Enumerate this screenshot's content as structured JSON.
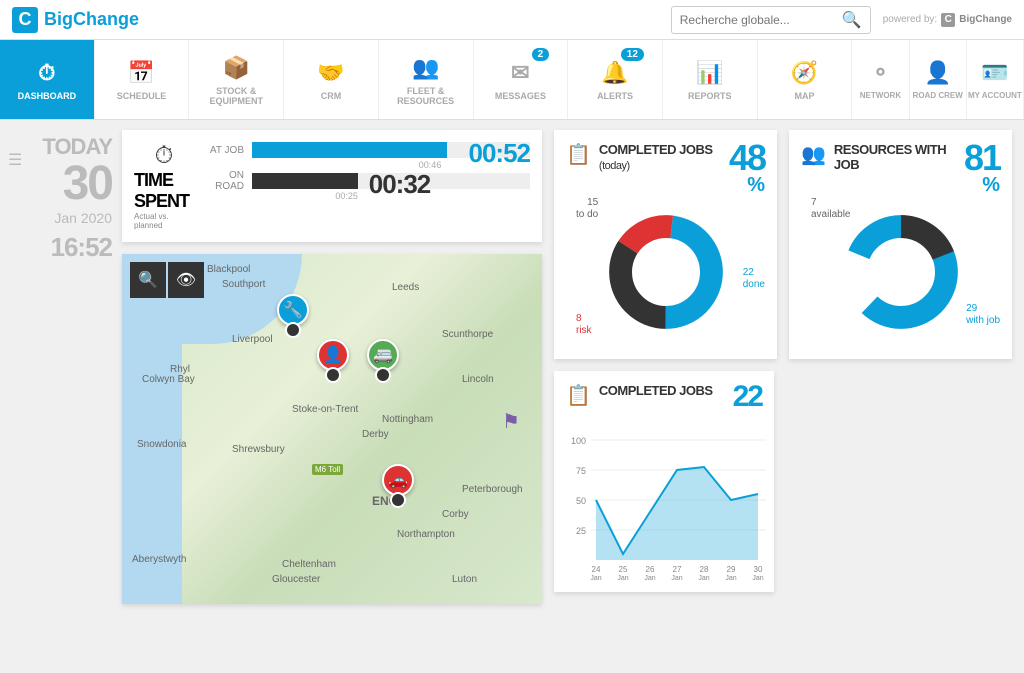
{
  "brand": "BigChange",
  "search_placeholder": "Recherche globale...",
  "powered_by": "powered by:",
  "powered_brand": "BigChange",
  "nav": [
    {
      "label": "DASHBOARD"
    },
    {
      "label": "SCHEDULE"
    },
    {
      "label": "STOCK & EQUIPMENT"
    },
    {
      "label": "CRM"
    },
    {
      "label": "FLEET & RESOURCES"
    },
    {
      "label": "MESSAGES",
      "badge": "2"
    },
    {
      "label": "ALERTS",
      "badge": "12"
    },
    {
      "label": "REPORTS"
    },
    {
      "label": "MAP"
    },
    {
      "label": "NETWORK"
    },
    {
      "label": "ROAD CREW"
    },
    {
      "label": "MY ACCOUNT"
    }
  ],
  "date": {
    "today": "TODAY",
    "day": "30",
    "month": "Jan 2020",
    "time": "16:52"
  },
  "time_spent": {
    "title": "TIME SPENT",
    "sub": "Actual vs. planned",
    "at_job_label": "AT JOB",
    "at_job_actual": "00:52",
    "at_job_planned": "00:46",
    "on_road_label": "ON ROAD",
    "on_road_actual": "00:32",
    "on_road_planned": "00:25"
  },
  "completed_today": {
    "title": "COMPLETED JOBS",
    "sub": "(today)",
    "value": "48",
    "pct": "%",
    "todo_n": "15",
    "todo_l": "to do",
    "risk_n": "8",
    "risk_l": "risk",
    "done_n": "22",
    "done_l": "done"
  },
  "resources": {
    "title": "RESOURCES WITH JOB",
    "value": "81",
    "pct": "%",
    "avail_n": "7",
    "avail_l": "available",
    "with_n": "29",
    "with_l": "with job"
  },
  "completed_jobs": {
    "title": "COMPLETED JOBS",
    "value": "22"
  },
  "chart_data": {
    "type": "line",
    "title": "COMPLETED JOBS",
    "xlabel": "",
    "ylabel": "",
    "ylim": [
      0,
      100
    ],
    "x": [
      "24 Jan",
      "25 Jan",
      "26 Jan",
      "27 Jan",
      "28 Jan",
      "29 Jan",
      "30 Jan"
    ],
    "values": [
      50,
      5,
      40,
      75,
      78,
      50,
      55
    ]
  },
  "map_cities": [
    "Liverpool",
    "Leeds",
    "Scunthorpe",
    "Lincoln",
    "Stoke-on-Trent",
    "Nottingham",
    "Derby",
    "Shrewsbury",
    "Peterborough",
    "ENGL",
    "Corby",
    "Northampton",
    "Cheltenham",
    "Gloucester",
    "Luton",
    "Southport",
    "Blackpool",
    "Rhyl",
    "Colwyn Bay",
    "Snowdonia",
    "Aberystwyth",
    "M6 Toll"
  ]
}
